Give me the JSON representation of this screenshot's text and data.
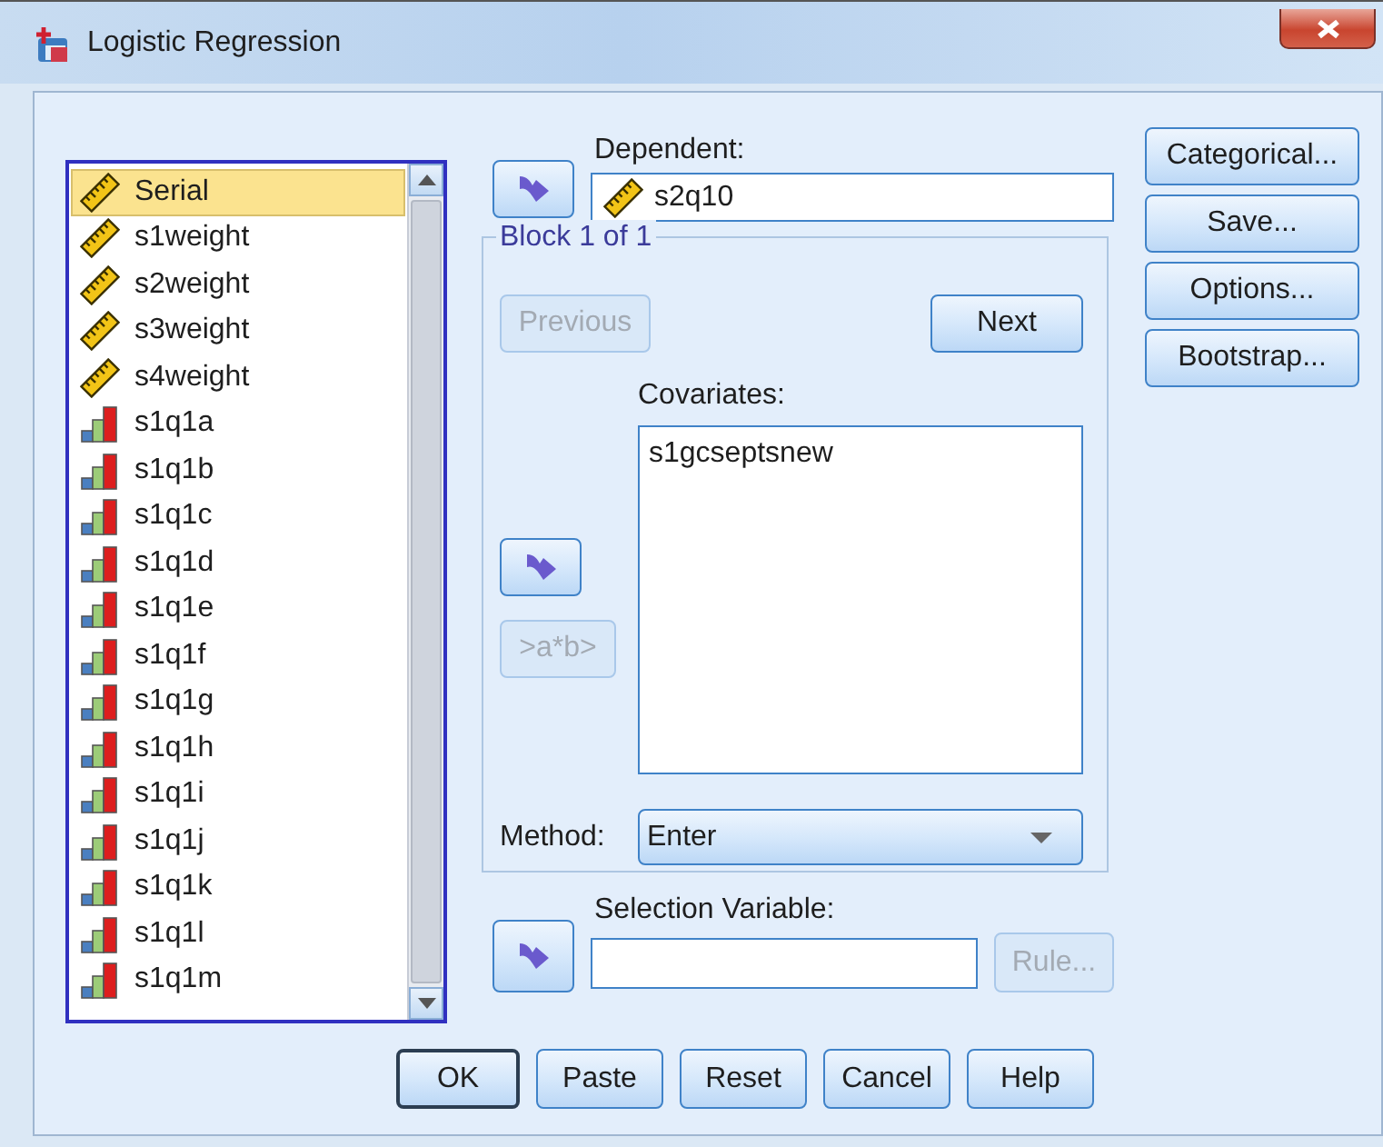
{
  "window": {
    "title": "Logistic Regression"
  },
  "variables": [
    {
      "name": "Serial",
      "kind": "scale",
      "selected": true
    },
    {
      "name": "s1weight",
      "kind": "scale",
      "selected": false
    },
    {
      "name": "s2weight",
      "kind": "scale",
      "selected": false
    },
    {
      "name": "s3weight",
      "kind": "scale",
      "selected": false
    },
    {
      "name": "s4weight",
      "kind": "scale",
      "selected": false
    },
    {
      "name": "s1q1a",
      "kind": "ordinal",
      "selected": false
    },
    {
      "name": "s1q1b",
      "kind": "ordinal",
      "selected": false
    },
    {
      "name": "s1q1c",
      "kind": "ordinal",
      "selected": false
    },
    {
      "name": "s1q1d",
      "kind": "ordinal",
      "selected": false
    },
    {
      "name": "s1q1e",
      "kind": "ordinal",
      "selected": false
    },
    {
      "name": "s1q1f",
      "kind": "ordinal",
      "selected": false
    },
    {
      "name": "s1q1g",
      "kind": "ordinal",
      "selected": false
    },
    {
      "name": "s1q1h",
      "kind": "ordinal",
      "selected": false
    },
    {
      "name": "s1q1i",
      "kind": "ordinal",
      "selected": false
    },
    {
      "name": "s1q1j",
      "kind": "ordinal",
      "selected": false
    },
    {
      "name": "s1q1k",
      "kind": "ordinal",
      "selected": false
    },
    {
      "name": "s1q1l",
      "kind": "ordinal",
      "selected": false
    },
    {
      "name": "s1q1m",
      "kind": "ordinal",
      "selected": false
    }
  ],
  "dependent": {
    "label": "Dependent:",
    "value": "s2q10",
    "kind": "scale"
  },
  "block": {
    "title": "Block 1 of 1",
    "previous": {
      "label": "Previous",
      "disabled": true
    },
    "next": {
      "label": "Next",
      "disabled": false
    },
    "covariates_label": "Covariates:",
    "covariates": [
      "s1gcseptsnew"
    ],
    "interaction": {
      "label": ">a*b>",
      "disabled": true
    },
    "method_label": "Method:",
    "method": "Enter"
  },
  "selection": {
    "label": "Selection Variable:",
    "rule": {
      "label": "Rule...",
      "disabled": true
    }
  },
  "side_buttons": [
    {
      "label": "Categorical..."
    },
    {
      "label": "Save..."
    },
    {
      "label": "Options..."
    },
    {
      "label": "Bootstrap..."
    }
  ],
  "footer_buttons": [
    {
      "label": "OK",
      "default": true
    },
    {
      "label": "Paste",
      "default": false
    },
    {
      "label": "Reset",
      "default": false
    },
    {
      "label": "Cancel",
      "default": false
    },
    {
      "label": "Help",
      "default": false
    }
  ]
}
